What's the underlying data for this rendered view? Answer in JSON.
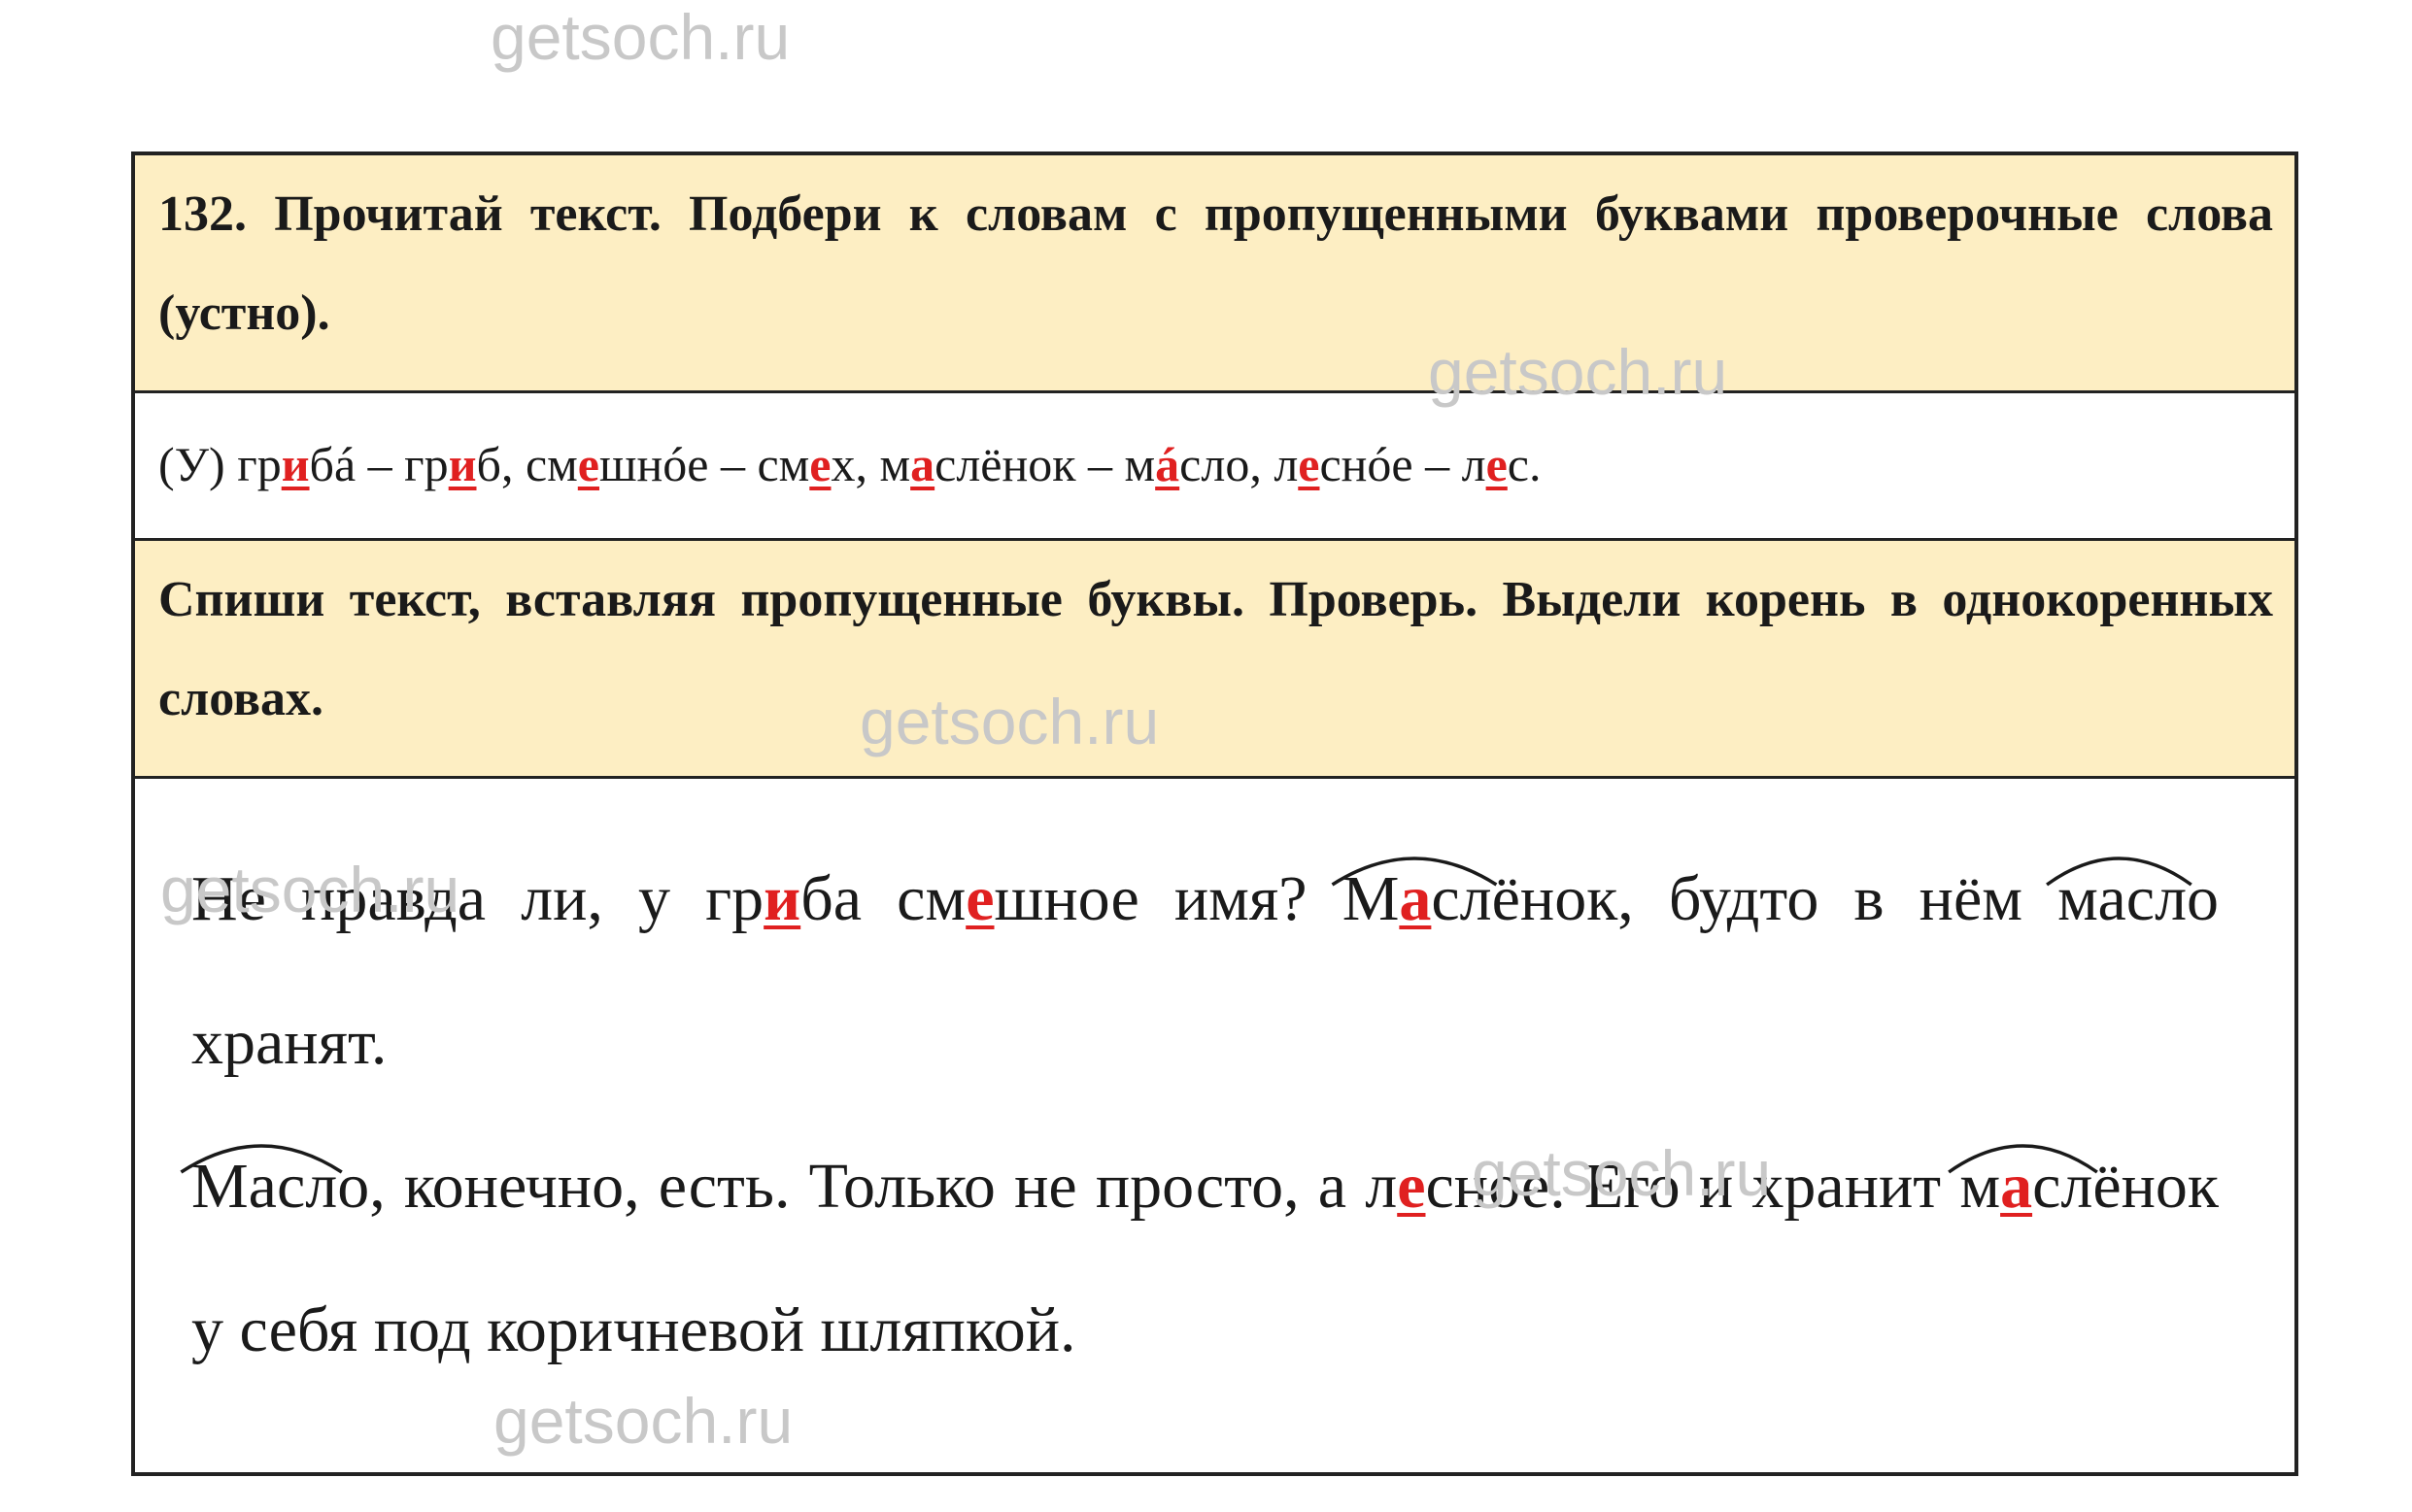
{
  "watermark": "getsoch.ru",
  "task1": {
    "text": "132. Прочитай текст. Подбери к словам с пропущенными буквами проверочные слова (устно)."
  },
  "answer1": {
    "label": "(У)",
    "pairs": [
      {
        "w1_a": "гр",
        "w1_l": "и",
        "w1_b": "бá",
        "dash": " – ",
        "w2_a": "гр",
        "w2_l": "и",
        "w2_b": "б",
        "sep": ", "
      },
      {
        "w1_a": "см",
        "w1_l": "е",
        "w1_b": "шнóе",
        "dash": " – ",
        "w2_a": "см",
        "w2_l": "е",
        "w2_b": "х",
        "sep": ", "
      },
      {
        "w1_a": "м",
        "w1_l": "а",
        "w1_b": "слёнок",
        "dash": " – ",
        "w2_a": "м",
        "w2_l": "á",
        "w2_b": "сло",
        "sep": ", "
      },
      {
        "w1_a": "л",
        "w1_l": "е",
        "w1_b": "снóе",
        "dash": " – ",
        "w2_a": "л",
        "w2_l": "е",
        "w2_b": "с",
        "sep": "."
      }
    ]
  },
  "task2": {
    "text": "Спиши текст, вставляя пропущенные буквы. Проверь. Выдели корень в однокоренных словах."
  },
  "answer2": {
    "p1": {
      "t1": "Не правда ли, у гр",
      "l1": "и",
      "t2": "ба см",
      "l2": "е",
      "t3": "шное имя? ",
      "r1_a": "М",
      "r1_l": "а",
      "r1_b": "сл",
      "t4": "ёнок, будто в нём ",
      "r2": "масл",
      "t5": "о хранят."
    },
    "p2": {
      "r1": "Масл",
      "t1": "о, конечно, есть. Только не просто, а л",
      "l1": "е",
      "t2": "сное. Его и хранит ",
      "r2_a": "м",
      "r2_l": "а",
      "r2_b": "сл",
      "t3": "ёнок у себя под коричневой шляпкой."
    }
  }
}
